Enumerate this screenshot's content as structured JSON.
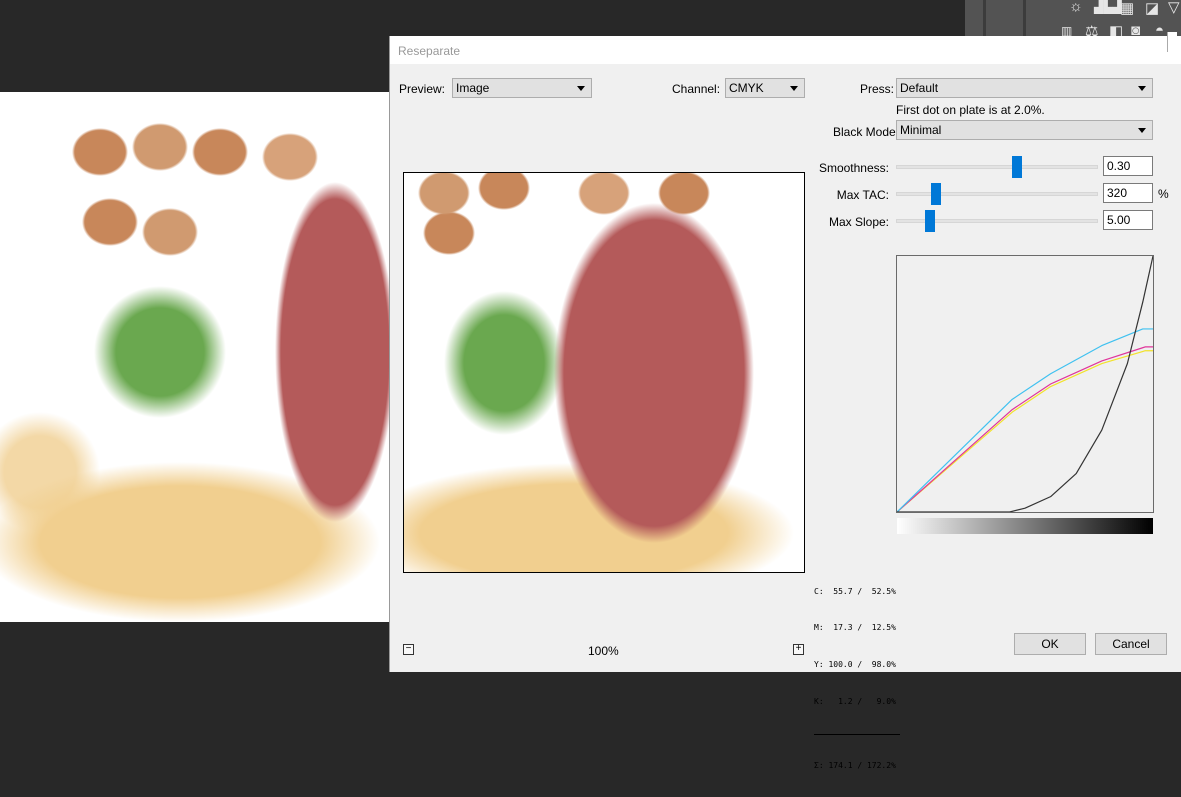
{
  "dialog": {
    "title": "Reseparate"
  },
  "preview": {
    "label": "Preview:",
    "value": "Image",
    "zoom": "100%",
    "zoom_out": "−",
    "zoom_in": "+"
  },
  "channel": {
    "label": "Channel:",
    "value": "CMYK"
  },
  "press": {
    "label": "Press:",
    "value": "Default",
    "note": "First dot on plate is at 2.0%."
  },
  "black_mode": {
    "label": "Black Mode:",
    "value": "Minimal"
  },
  "sliders": [
    {
      "label": "Smoothness:",
      "value": "0.30",
      "position": 0.6,
      "unit": ""
    },
    {
      "label": "Max TAC:",
      "value": "320",
      "position": 0.2,
      "unit": "%"
    },
    {
      "label": "Max Slope:",
      "value": "5.00",
      "position": 0.17,
      "unit": ""
    }
  ],
  "readout": {
    "c": "C:  55.7 /  52.5%",
    "m": "M:  17.3 /  12.5%",
    "y": "Y: 100.0 /  98.0%",
    "k": "K:   1.2 /   9.0%",
    "sum": "Σ: 174.1 / 172.2%"
  },
  "buttons": {
    "ok": "OK",
    "cancel": "Cancel"
  },
  "colors": {
    "cyan": "#3fc1f0",
    "magenta": "#e0359b",
    "yellow": "#f2e22a",
    "black": "#333333",
    "accent": "#0078d7"
  },
  "chart_data": {
    "type": "line",
    "xlim": [
      0,
      100
    ],
    "ylim": [
      0,
      100
    ],
    "series": [
      {
        "name": "Yellow",
        "color": "#f2e22a",
        "points": [
          [
            0,
            0
          ],
          [
            45,
            39
          ],
          [
            60,
            49
          ],
          [
            80,
            58
          ],
          [
            97,
            63
          ],
          [
            100,
            63
          ]
        ]
      },
      {
        "name": "Magenta",
        "color": "#e0359b",
        "points": [
          [
            0,
            0
          ],
          [
            45,
            40
          ],
          [
            60,
            50
          ],
          [
            80,
            59
          ],
          [
            97,
            64.5
          ],
          [
            100,
            64.5
          ]
        ]
      },
      {
        "name": "Cyan",
        "color": "#3fc1f0",
        "points": [
          [
            0,
            0
          ],
          [
            45,
            44
          ],
          [
            60,
            54
          ],
          [
            80,
            65
          ],
          [
            96,
            71.5
          ],
          [
            100,
            71.5
          ]
        ]
      },
      {
        "name": "Black",
        "color": "#333333",
        "points": [
          [
            0,
            0
          ],
          [
            44,
            0
          ],
          [
            50,
            1.5
          ],
          [
            60,
            6
          ],
          [
            70,
            15
          ],
          [
            80,
            32
          ],
          [
            90,
            58
          ],
          [
            96,
            82
          ],
          [
            100,
            100
          ]
        ]
      }
    ]
  }
}
